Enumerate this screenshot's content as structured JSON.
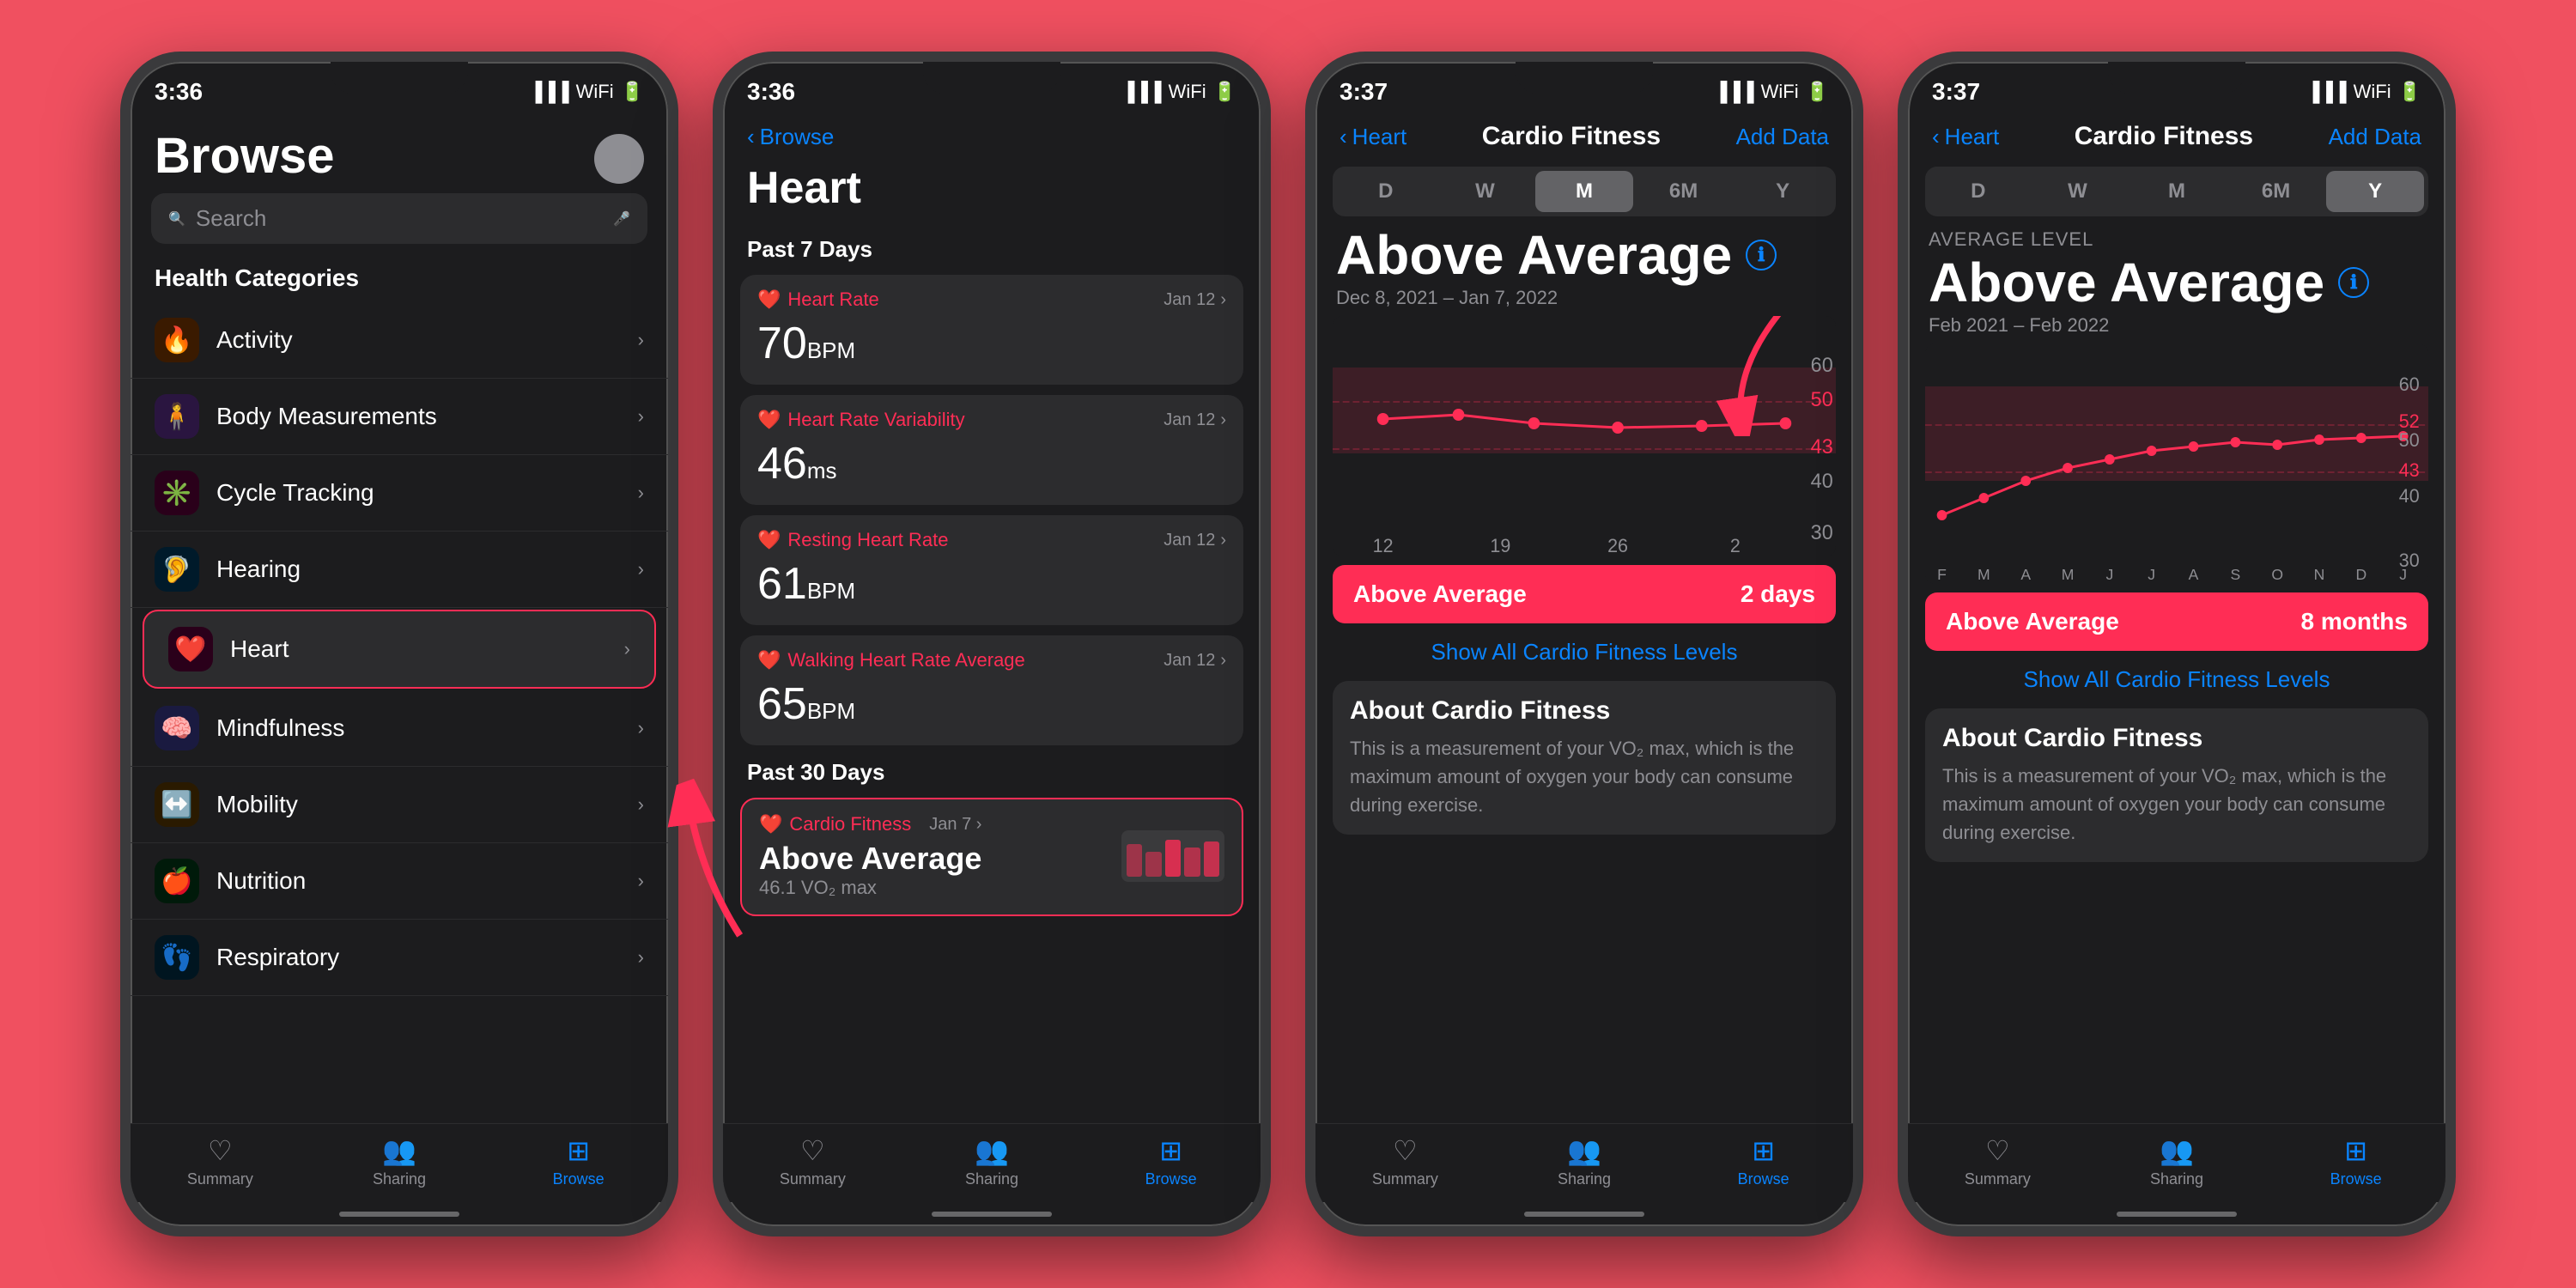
{
  "background": "#f05060",
  "phones": [
    {
      "id": "browse",
      "status_time": "3:36",
      "screen": "browse",
      "title": "Browse",
      "search_placeholder": "Search",
      "section_title": "Health Categories",
      "categories": [
        {
          "name": "Activity",
          "icon": "🔥",
          "icon_bg": "#ff6b35",
          "highlighted": false
        },
        {
          "name": "Body Measurements",
          "icon": "🧍",
          "icon_bg": "#9b59b6",
          "highlighted": false
        },
        {
          "name": "Cycle Tracking",
          "icon": "✳️",
          "icon_bg": "#ff2d55",
          "highlighted": false
        },
        {
          "name": "Hearing",
          "icon": "🦻",
          "icon_bg": "#5ac8fa",
          "highlighted": false
        },
        {
          "name": "Heart",
          "icon": "❤️",
          "icon_bg": "#ff2d55",
          "highlighted": true
        },
        {
          "name": "Mindfulness",
          "icon": "🧠",
          "icon_bg": "#5856d6",
          "highlighted": false
        },
        {
          "name": "Mobility",
          "icon": "⟷",
          "icon_bg": "#ff9f0a",
          "highlighted": false
        },
        {
          "name": "Nutrition",
          "icon": "🍎",
          "icon_bg": "#30d158",
          "highlighted": false
        },
        {
          "name": "Respiratory",
          "icon": "👣",
          "icon_bg": "#5ac8fa",
          "highlighted": false
        }
      ],
      "tabs": [
        {
          "label": "Summary",
          "icon": "♡",
          "active": false
        },
        {
          "label": "Sharing",
          "icon": "👥",
          "active": false
        },
        {
          "label": "Browse",
          "icon": "⊞",
          "active": true
        }
      ]
    },
    {
      "id": "heart",
      "status_time": "3:36",
      "screen": "heart",
      "back_label": "Browse",
      "title": "Heart",
      "section1": "Past 7 Days",
      "metrics": [
        {
          "label": "Heart Rate",
          "date": "Jan 12",
          "value": "70",
          "unit": "BPM"
        },
        {
          "label": "Heart Rate Variability",
          "date": "Jan 12",
          "value": "46",
          "unit": "ms"
        },
        {
          "label": "Resting Heart Rate",
          "date": "Jan 12",
          "value": "61",
          "unit": "BPM"
        },
        {
          "label": "Walking Heart Rate Average",
          "date": "Jan 12",
          "value": "65",
          "unit": "BPM"
        }
      ],
      "section2": "Past 30 Days",
      "cardio": {
        "label": "Cardio Fitness",
        "date": "Jan 7",
        "value": "Above Average",
        "subvalue": "46.1 VO₂ max"
      },
      "tabs": [
        {
          "label": "Summary",
          "icon": "♡",
          "active": false
        },
        {
          "label": "Sharing",
          "icon": "👥",
          "active": false
        },
        {
          "label": "Browse",
          "icon": "⊞",
          "active": true
        }
      ]
    },
    {
      "id": "cardio-m",
      "status_time": "3:37",
      "screen": "cardio",
      "back_label": "Heart",
      "nav_title": "Cardio Fitness",
      "add_data": "Add Data",
      "filters": [
        "D",
        "W",
        "M",
        "6M",
        "Y"
      ],
      "active_filter": "M",
      "avg_level_label": "",
      "avg_value": "Above Average",
      "date_range": "Dec 8, 2021 – Jan 7, 2022",
      "chart_y_labels": [
        "60",
        "50",
        "43",
        "40",
        "30"
      ],
      "x_labels": [
        "12",
        "19",
        "26",
        "2"
      ],
      "status_label": "Above Average",
      "status_value": "2 days",
      "show_all": "Show All Cardio Fitness Levels",
      "about_title": "About Cardio Fitness",
      "about_text": "This is a measurement of your VO₂ max, which is the maximum amount of oxygen your body can consume during exercise.",
      "tabs": [
        {
          "label": "Summary",
          "icon": "♡",
          "active": false
        },
        {
          "label": "Sharing",
          "icon": "👥",
          "active": false
        },
        {
          "label": "Browse",
          "icon": "⊞",
          "active": true
        }
      ]
    },
    {
      "id": "cardio-y",
      "status_time": "3:37",
      "screen": "cardio",
      "back_label": "Heart",
      "nav_title": "Cardio Fitness",
      "add_data": "Add Data",
      "filters": [
        "D",
        "W",
        "M",
        "6M",
        "Y"
      ],
      "active_filter": "Y",
      "avg_level_label": "AVERAGE LEVEL",
      "avg_value": "Above Average",
      "date_range": "Feb 2021 – Feb 2022",
      "chart_y_labels": [
        "60",
        "52",
        "50",
        "43",
        "40",
        "30"
      ],
      "x_labels": [
        "F",
        "M",
        "A",
        "M",
        "J",
        "J",
        "A",
        "S",
        "O",
        "N",
        "D",
        "J"
      ],
      "status_label": "Above Average",
      "status_value": "8 months",
      "show_all": "Show All Cardio Fitness Levels",
      "about_title": "About Cardio Fitness",
      "about_text": "This is a measurement of your VO₂ max, which is the maximum amount of oxygen your body can consume during exercise.",
      "tabs": [
        {
          "label": "Summary",
          "icon": "♡",
          "active": false
        },
        {
          "label": "Sharing",
          "icon": "👥",
          "active": false
        },
        {
          "label": "Browse",
          "icon": "⊞",
          "active": true
        }
      ]
    }
  ]
}
